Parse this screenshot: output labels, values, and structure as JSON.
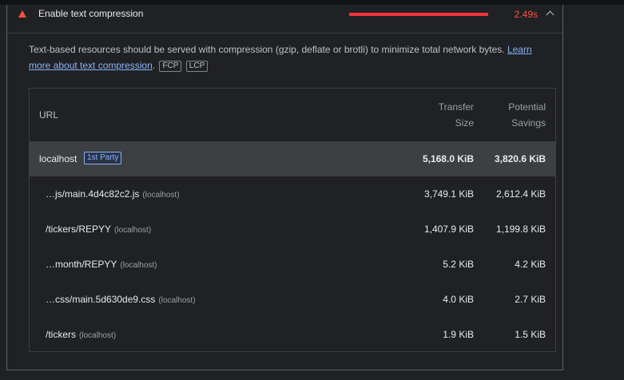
{
  "audit": {
    "title": "Enable text compression",
    "metric": "2.49s",
    "bar_fraction": 1.0,
    "status_color": "#ff4e42",
    "status_icon": "warning-triangle-icon",
    "expand_icon": "chevron-up-icon",
    "description": "Text-based resources should be served with compression (gzip, deflate or brotli) to minimize total network bytes. ",
    "learn_more": "Learn more about text compression",
    "description_end": ".",
    "tags": [
      "FCP",
      "LCP"
    ]
  },
  "table": {
    "headers": {
      "url": "URL",
      "transfer_line1": "Transfer",
      "transfer_line2": "Size",
      "savings_line1": "Potential",
      "savings_line2": "Savings"
    },
    "group": {
      "name": "localhost",
      "badge": "1st Party",
      "transfer": "5,168.0 KiB",
      "savings": "3,820.6 KiB"
    },
    "rows": [
      {
        "url": "…js/main.4d4c82c2.js",
        "host": "(localhost)",
        "transfer": "3,749.1 KiB",
        "savings": "2,612.4 KiB"
      },
      {
        "url": "/tickers/REPYY",
        "host": "(localhost)",
        "transfer": "1,407.9 KiB",
        "savings": "1,199.8 KiB"
      },
      {
        "url": "…month/REPYY",
        "host": "(localhost)",
        "transfer": "5.2 KiB",
        "savings": "4.2 KiB"
      },
      {
        "url": "…css/main.5d630de9.css",
        "host": "(localhost)",
        "transfer": "4.0 KiB",
        "savings": "2.7 KiB"
      },
      {
        "url": "/tickers",
        "host": "(localhost)",
        "transfer": "1.9 KiB",
        "savings": "1.5 KiB"
      }
    ]
  }
}
